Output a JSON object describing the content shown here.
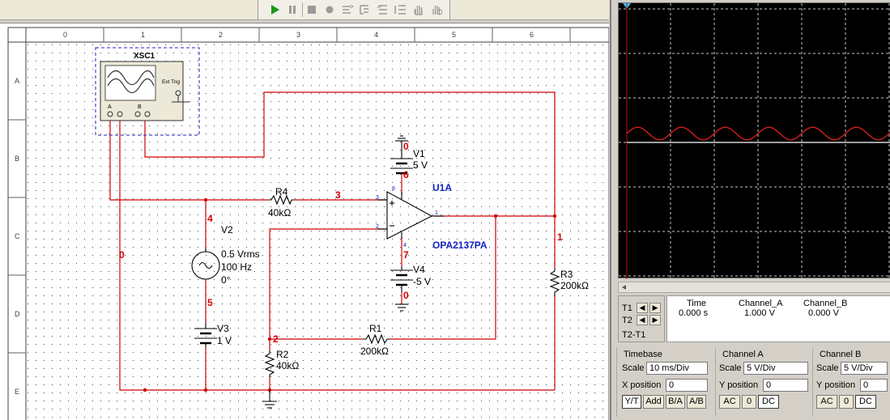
{
  "toolbar": {
    "buttons": [
      "run",
      "pause",
      "stop",
      "record",
      "step",
      "step-into",
      "step-over",
      "hand",
      "breakpoint"
    ]
  },
  "schematic": {
    "ruler_cols": [
      "0",
      "1",
      "2",
      "3",
      "4",
      "5",
      "6"
    ],
    "ruler_rows": [
      "A",
      "B",
      "C",
      "D",
      "E"
    ],
    "scope_instrument": {
      "name": "XSC1",
      "ext_trig": "Ext Trig",
      "ch_a": "A",
      "ch_b": "B"
    },
    "components": {
      "V1": {
        "ref": "V1",
        "value": "5 V"
      },
      "V2": {
        "ref": "V2",
        "line1": "0.5 Vrms",
        "line2": "100 Hz",
        "line3": "0°"
      },
      "V3": {
        "ref": "V3",
        "value": "1 V"
      },
      "V4": {
        "ref": "V4",
        "value": "-5 V"
      },
      "R1": {
        "ref": "R1",
        "value": "200kΩ"
      },
      "R2": {
        "ref": "R2",
        "value": "40kΩ"
      },
      "R3": {
        "ref": "R3",
        "value": "200kΩ"
      },
      "R4": {
        "ref": "R4",
        "value": "40kΩ"
      },
      "U1A": {
        "ref": "U1A",
        "part": "OPA2137PA",
        "pin_inp": "3",
        "pin_inn": "2",
        "pin_out": "1",
        "pin_vp": "8",
        "pin_vn": "4"
      }
    },
    "nets": {
      "n0": "0",
      "n0b": "0",
      "n0c": "0",
      "n1": "1",
      "n2": "2",
      "n3": "3",
      "n4": "4",
      "n5": "5",
      "n6": "6",
      "n7": "7"
    }
  },
  "oscilloscope": {
    "readout": {
      "t1_label": "T1",
      "t2_label": "T2",
      "t2t1_label": "T2-T1",
      "headers": {
        "time": "Time",
        "ch_a": "Channel_A",
        "ch_b": "Channel_B"
      },
      "time": "0.000 s",
      "ch_a_value": "1.000 V",
      "ch_b_value": "0.000 V"
    },
    "timebase": {
      "title": "Timebase",
      "scale_label": "Scale",
      "scale_value": "10 ms/Div",
      "xpos_label": "X position",
      "xpos_value": "0",
      "btn_yt": "Y/T",
      "btn_add": "Add",
      "btn_ba": "B/A",
      "btn_ab": "A/B"
    },
    "channel_a": {
      "title": "Channel A",
      "scale_label": "Scale",
      "scale_value": "5 V/Div",
      "ypos_label": "Y position",
      "ypos_value": "0",
      "btn_ac": "AC",
      "btn_0": "0",
      "btn_dc": "DC"
    },
    "channel_b": {
      "title": "Channel B",
      "scale_label": "Scale",
      "scale_value": "5 V/Div",
      "ypos_label": "Y position",
      "ypos_value": "0",
      "btn_ac": "AC",
      "btn_0": "0",
      "btn_dc": "DC"
    },
    "colors": {
      "trace_a": "#e02020",
      "trace_b": "#ffffff",
      "grid": "#c8c8c8",
      "screen_bg": "#000000"
    }
  },
  "colors": {
    "wire": "#d00000",
    "net_label": "#d00000",
    "part_label": "#1020c0",
    "component": "#000000"
  }
}
